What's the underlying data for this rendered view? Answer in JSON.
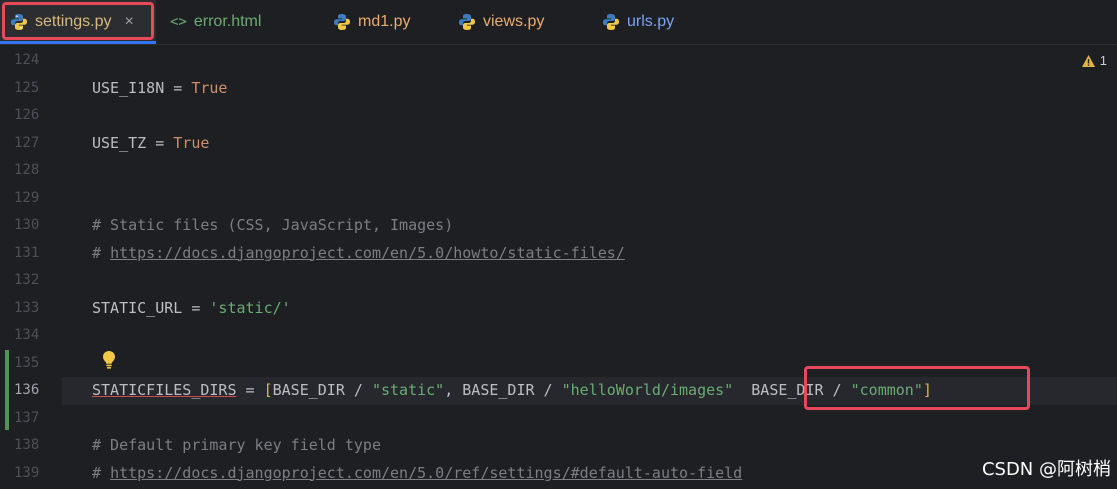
{
  "tabs": [
    {
      "label": "settings.py",
      "icon": "python-icon",
      "active": true,
      "close": "×"
    },
    {
      "label": "error.html",
      "icon": "html-icon",
      "icon_glyph": "<>"
    },
    {
      "label": "md1.py",
      "icon": "python-icon"
    },
    {
      "label": "views.py",
      "icon": "python-icon"
    },
    {
      "label": "urls.py",
      "icon": "python-icon"
    }
  ],
  "warnings": {
    "count": "1",
    "icon": "warning-icon"
  },
  "lines": [
    {
      "num": "124"
    },
    {
      "num": "125",
      "segments": [
        {
          "t": "USE_I18N = ",
          "c": ""
        },
        {
          "t": "True",
          "c": "kw"
        }
      ]
    },
    {
      "num": "126"
    },
    {
      "num": "127",
      "segments": [
        {
          "t": "USE_TZ = ",
          "c": ""
        },
        {
          "t": "True",
          "c": "kw"
        }
      ]
    },
    {
      "num": "128"
    },
    {
      "num": "129"
    },
    {
      "num": "130",
      "segments": [
        {
          "t": "# Static files (CSS, JavaScript, Images)",
          "c": "cmt"
        }
      ]
    },
    {
      "num": "131",
      "segments": [
        {
          "t": "# ",
          "c": "cmt"
        },
        {
          "t": "https://docs.djangoproject.com/en/5.0/howto/static-files/",
          "c": "link"
        }
      ]
    },
    {
      "num": "132"
    },
    {
      "num": "133",
      "segments": [
        {
          "t": "STATIC_URL = ",
          "c": ""
        },
        {
          "t": "'static/'",
          "c": "str"
        }
      ]
    },
    {
      "num": "134"
    },
    {
      "num": "135"
    },
    {
      "num": "136",
      "current": true,
      "segments": [
        {
          "t": "STATICFILES_DIRS",
          "c": "var-under"
        },
        {
          "t": " = ",
          "c": ""
        },
        {
          "t": "[",
          "c": "bracket"
        },
        {
          "t": "BASE_DIR / ",
          "c": ""
        },
        {
          "t": "\"static\"",
          "c": "str"
        },
        {
          "t": ", BASE_DIR / ",
          "c": ""
        },
        {
          "t": "\"helloWorld/images\"",
          "c": "str"
        },
        {
          "t": "  BASE_DIR / ",
          "c": ""
        },
        {
          "t": "\"common\"",
          "c": "str"
        },
        {
          "t": "]",
          "c": "bracket"
        }
      ]
    },
    {
      "num": "137"
    },
    {
      "num": "138",
      "segments": [
        {
          "t": "# Default primary key field type",
          "c": "cmt"
        }
      ]
    },
    {
      "num": "139",
      "segments": [
        {
          "t": "# ",
          "c": "cmt"
        },
        {
          "t": "https://docs.djangoproject.com/en/5.0/ref/settings/#default-auto-field",
          "c": "link"
        }
      ]
    }
  ],
  "watermark": "CSDN @阿树梢"
}
